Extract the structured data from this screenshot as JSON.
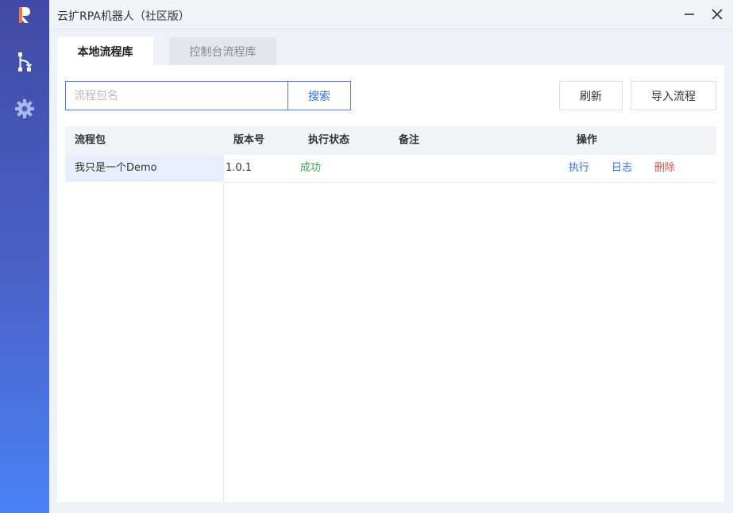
{
  "window": {
    "title": "云扩RPA机器人（社区版）"
  },
  "sidebar": {
    "logo": "R",
    "items": [
      {
        "name": "flow-icon"
      },
      {
        "name": "gear-icon"
      }
    ]
  },
  "tabs": [
    {
      "label": "本地流程库",
      "active": true
    },
    {
      "label": "控制台流程库",
      "active": false
    }
  ],
  "search": {
    "placeholder": "流程包名",
    "value": "",
    "button_label": "搜索"
  },
  "toolbar": {
    "refresh_label": "刷新",
    "import_label": "导入流程"
  },
  "table": {
    "headers": {
      "package": "流程包",
      "version": "版本号",
      "status": "执行状态",
      "note": "备注",
      "actions": "操作"
    },
    "packages": [
      "我只是一个Demo"
    ],
    "rows": [
      {
        "version": "1.0.1",
        "status": "成功",
        "note": "",
        "actions": {
          "run": "执行",
          "log": "日志",
          "delete": "删除"
        }
      }
    ]
  },
  "colors": {
    "accent": "#2f6bea",
    "success": "#3aa655",
    "danger": "#e8534f"
  }
}
